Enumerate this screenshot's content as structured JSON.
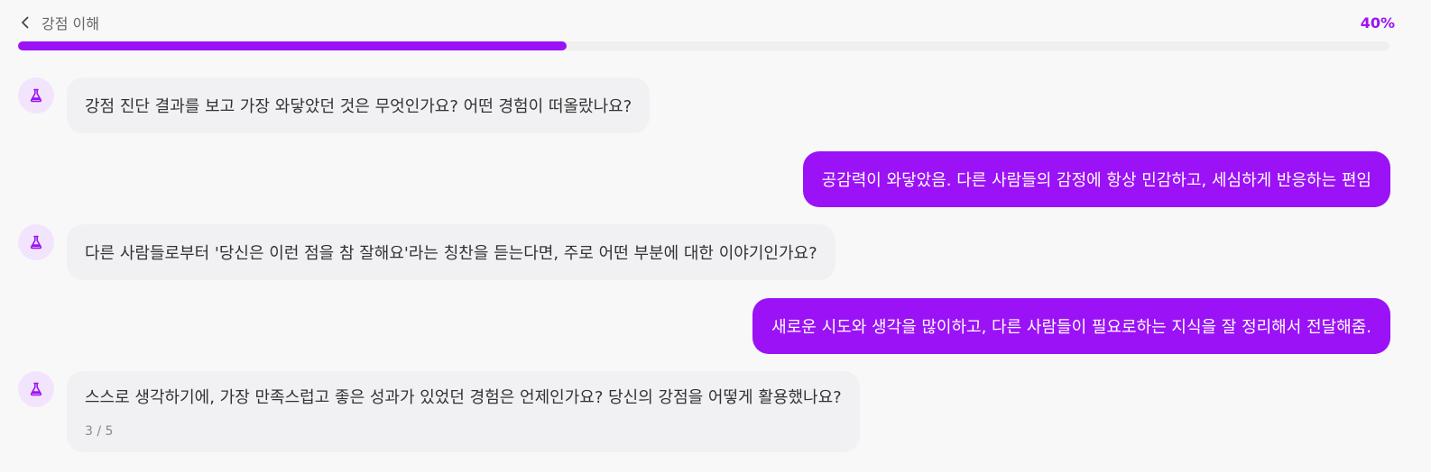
{
  "header": {
    "back_icon": "chevron-left-icon",
    "title": "강점 이해",
    "progress_text": "40%",
    "progress_value": 0.4,
    "accent_color": "#9b12f6"
  },
  "messages": [
    {
      "role": "bot",
      "icon": "flask-icon",
      "text": "강점 진단 결과를 보고 가장 와닿았던 것은 무엇인가요? 어떤 경험이 떠올랐나요?"
    },
    {
      "role": "user",
      "text": "공감력이 와닿았음. 다른 사람들의 감정에 항상 민감하고, 세심하게 반응하는 편임"
    },
    {
      "role": "bot",
      "icon": "flask-icon",
      "text": "다른 사람들로부터 '당신은 이런 점을 참 잘해요'라는 칭찬을 듣는다면, 주로 어떤 부분에 대한 이야기인가요?"
    },
    {
      "role": "user",
      "text": "새로운 시도와 생각을 많이하고, 다른 사람들이 필요로하는 지식을 잘 정리해서 전달해줌."
    },
    {
      "role": "bot",
      "icon": "flask-icon",
      "text": "스스로 생각하기에, 가장 만족스럽고 좋은 성과가 있었던 경험은 언제인가요? 당신의 강점을 어떻게 활용했나요?",
      "step": "3 / 5"
    }
  ]
}
